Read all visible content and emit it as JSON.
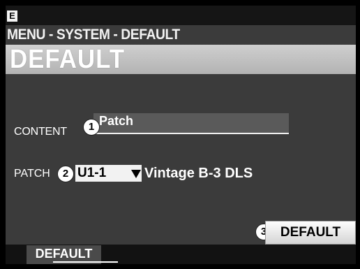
{
  "mode_badge": "E",
  "breadcrumb": "MENU - SYSTEM - DEFAULT",
  "page_title": "DEFAULT",
  "content": {
    "label": "CONTENT",
    "value": "Patch"
  },
  "patch": {
    "label": "PATCH",
    "number": "U1-1",
    "name": "Vintage B-3 DLS"
  },
  "callouts": [
    "1",
    "2",
    "3"
  ],
  "default_button": "DEFAULT",
  "tabs": [
    {
      "label": "DEFAULT",
      "selected": true
    }
  ],
  "colors": {
    "screen_bg": "#3b3b3b",
    "title_band": "#c4c4c4",
    "bars": "#151515"
  },
  "icons": {
    "dropdown": "triangle-down-icon"
  }
}
